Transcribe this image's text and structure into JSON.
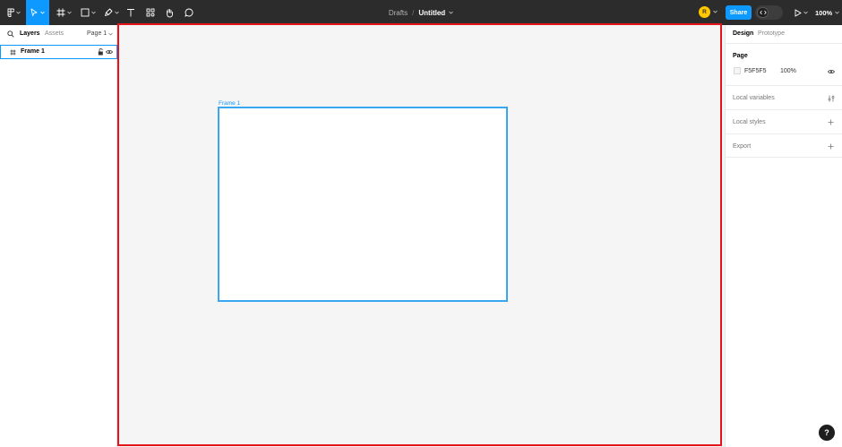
{
  "toolbar": {
    "tools": [
      {
        "name": "main-menu",
        "active": false
      },
      {
        "name": "move-tool",
        "active": true
      },
      {
        "name": "frame-tool",
        "active": false
      },
      {
        "name": "shape-tool",
        "active": false
      },
      {
        "name": "pen-tool",
        "active": false
      },
      {
        "name": "text-tool",
        "active": false
      },
      {
        "name": "resources-tool",
        "active": false
      },
      {
        "name": "hand-tool",
        "active": false
      },
      {
        "name": "comment-tool",
        "active": false
      }
    ],
    "breadcrumb_drafts": "Drafts",
    "breadcrumb_sep": "/",
    "file_name": "Untitled",
    "avatar_initial": "R",
    "share_label": "Share",
    "zoom_label": "100%"
  },
  "left_panel": {
    "tab_layers": "Layers",
    "tab_assets": "Assets",
    "page_label": "Page 1",
    "layers": [
      {
        "name": "Frame 1",
        "icon": "frame-icon",
        "selected": true
      }
    ]
  },
  "canvas": {
    "frame_label": "Frame 1",
    "background": "#f5f5f5"
  },
  "right_panel": {
    "tab_design": "Design",
    "tab_prototype": "Prototype",
    "page_section_title": "Page",
    "page_color_hex": "F5F5F5",
    "page_opacity": "100%",
    "local_variables": "Local variables",
    "local_styles": "Local styles",
    "export": "Export"
  },
  "help_label": "?",
  "colors": {
    "accent": "#0d99ff",
    "toolbar_bg": "#2c2c2c",
    "highlight": "#e5141b",
    "avatar": "#ffc700"
  }
}
